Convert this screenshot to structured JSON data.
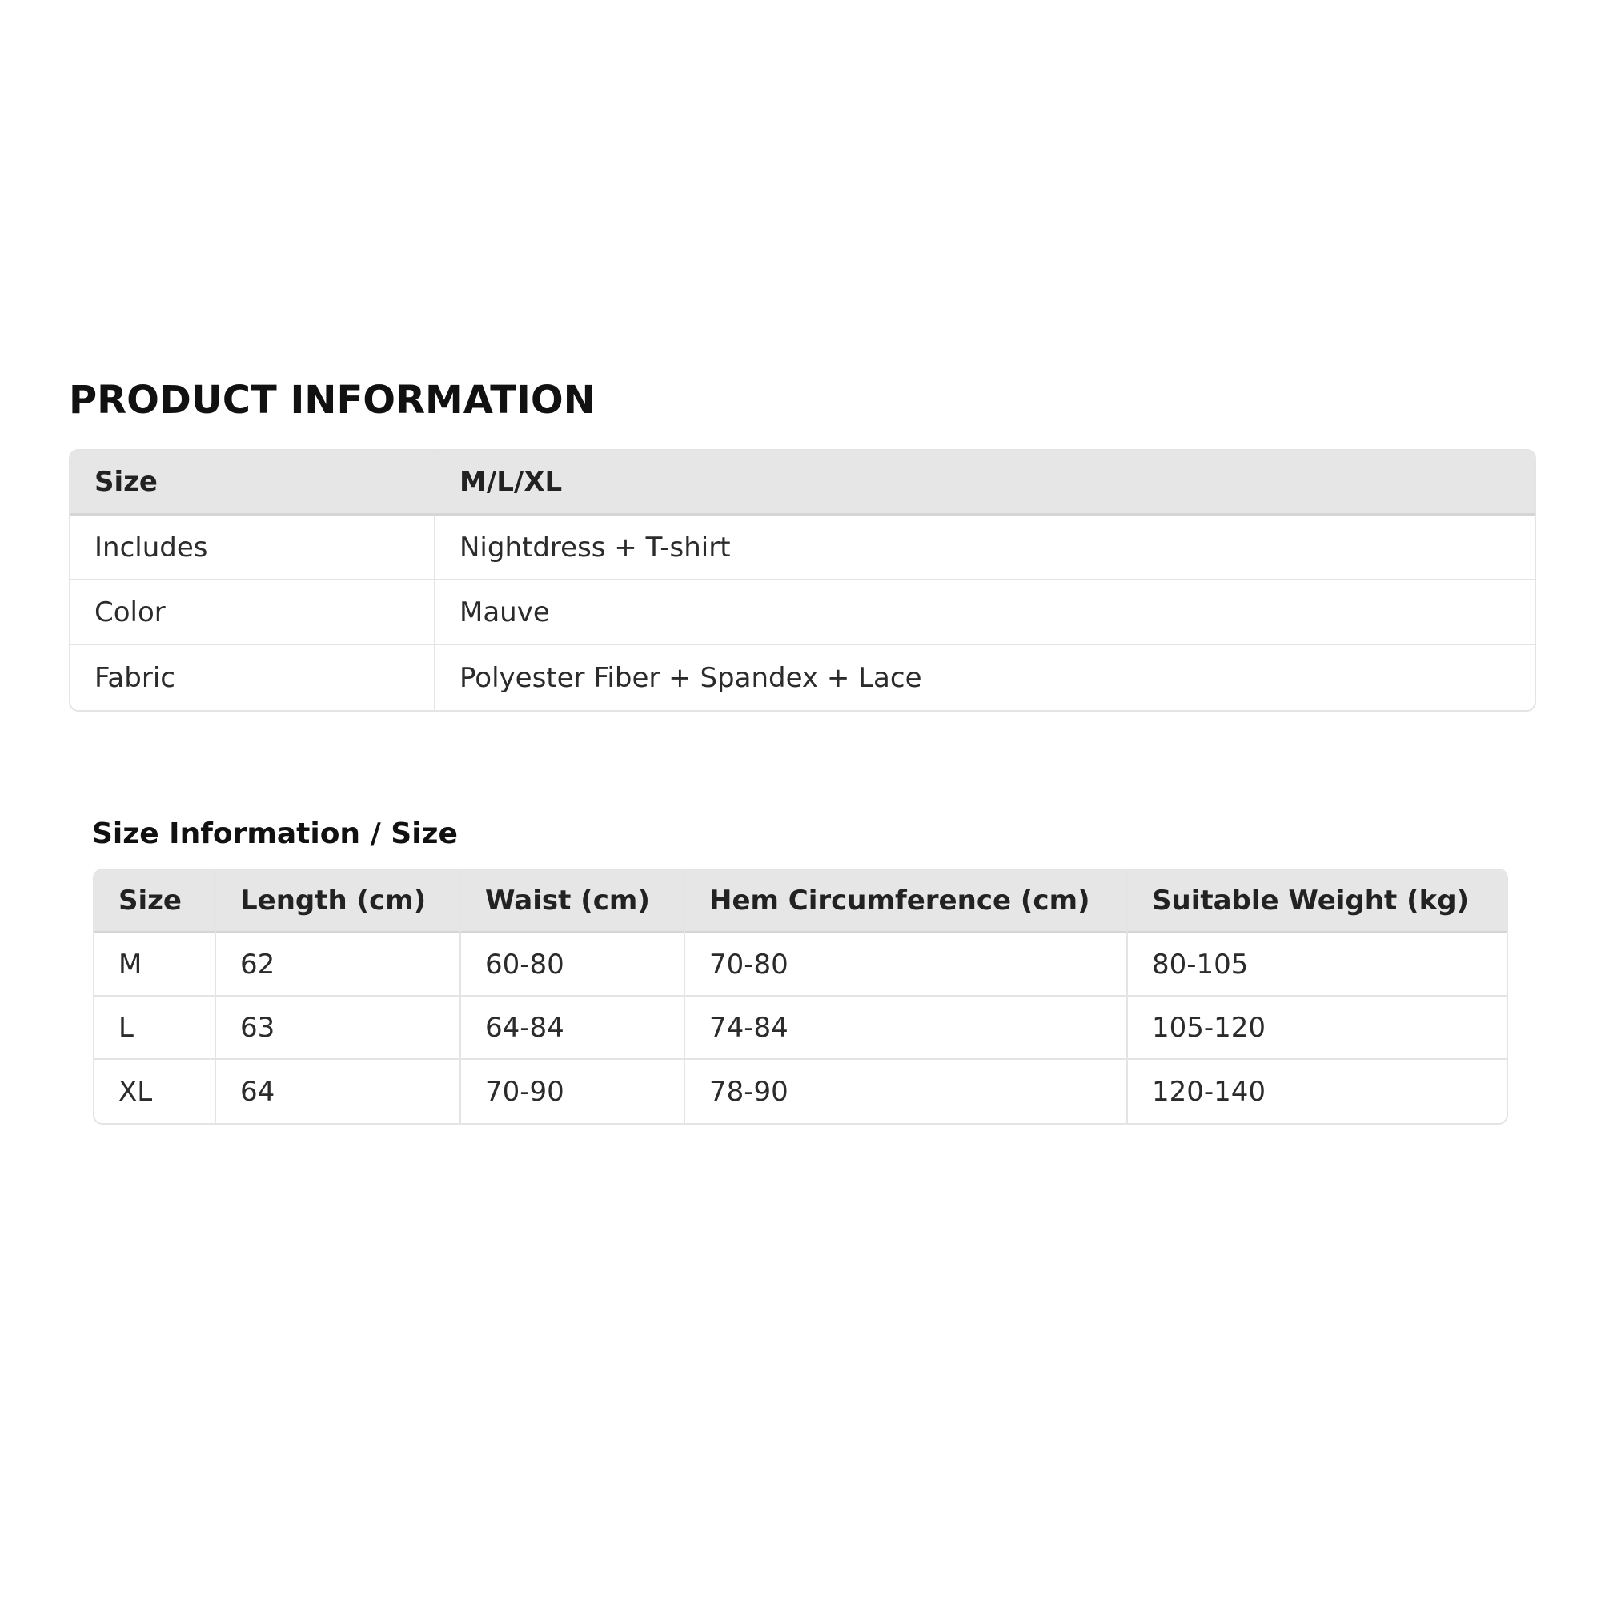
{
  "product_info": {
    "title": "PRODUCT INFORMATION",
    "rows": [
      {
        "label": "Size",
        "value": "M/L/XL"
      },
      {
        "label": "Includes",
        "value": "Nightdress + T-shirt"
      },
      {
        "label": "Color",
        "value": "Mauve"
      },
      {
        "label": "Fabric",
        "value": "Polyester Fiber + Spandex + Lace"
      }
    ]
  },
  "size_info": {
    "title": "Size Information / Size",
    "headers": [
      "Size",
      "Length (cm)",
      "Waist (cm)",
      "Hem Circumference (cm)",
      "Suitable Weight (kg)"
    ],
    "rows": [
      [
        "M",
        "62",
        "60-80",
        "70-80",
        "80-105"
      ],
      [
        "L",
        "63",
        "64-84",
        "74-84",
        "105-120"
      ],
      [
        "XL",
        "64",
        "70-90",
        "78-90",
        "120-140"
      ]
    ]
  },
  "colors": {
    "header_bg": "#e6e6e6",
    "border": "#e4e4e4",
    "text": "#2b2b2b"
  }
}
